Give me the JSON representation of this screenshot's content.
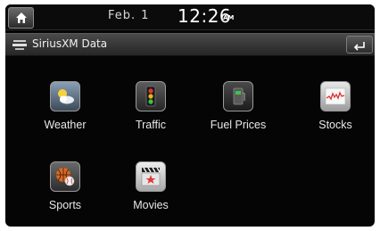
{
  "status_bar": {
    "date_month": "Feb.",
    "date_day": "1",
    "time": "12:26",
    "ampm": "AM"
  },
  "title_bar": {
    "title": "SiriusXM Data"
  },
  "apps": [
    {
      "label": "Weather",
      "icon": "weather-icon"
    },
    {
      "label": "Traffic",
      "icon": "traffic-light-icon"
    },
    {
      "label": "Fuel Prices",
      "icon": "fuel-pump-icon"
    },
    {
      "label": "Stocks",
      "icon": "stocks-chart-icon"
    },
    {
      "label": "Sports",
      "icon": "sports-balls-icon"
    },
    {
      "label": "Movies",
      "icon": "clapperboard-icon"
    }
  ],
  "colors": {
    "screen_bg": "#050505",
    "text": "#e8e8e8",
    "titlebar": "#3a3a3a"
  }
}
